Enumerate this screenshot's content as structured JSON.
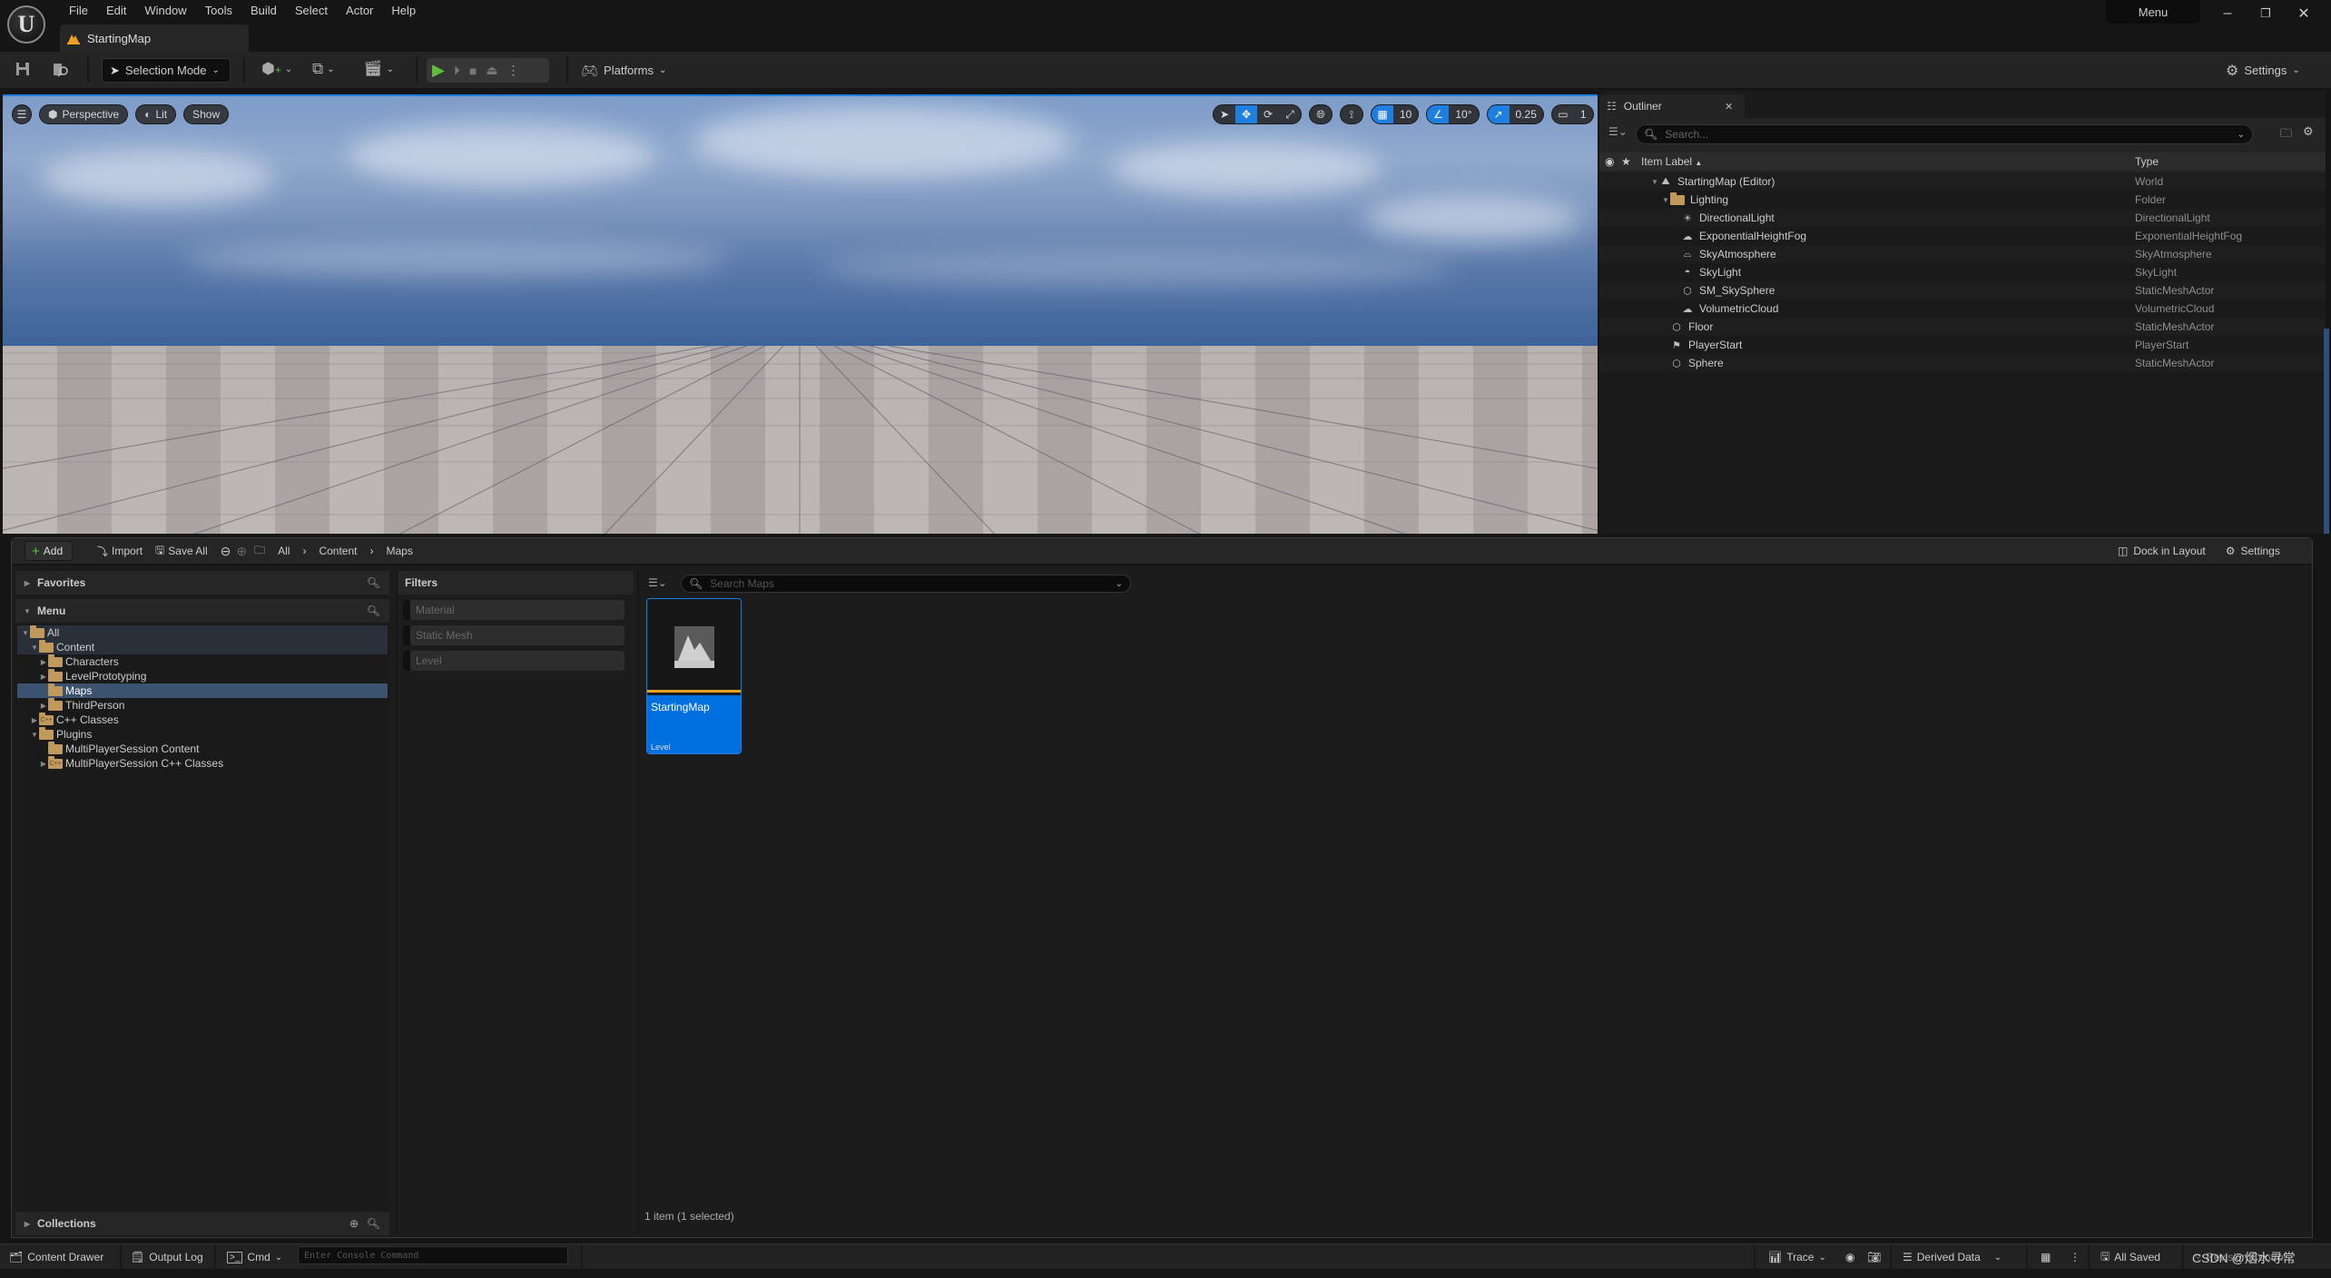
{
  "app": {
    "logo": "U",
    "menu": [
      "File",
      "Edit",
      "Window",
      "Tools",
      "Build",
      "Select",
      "Actor",
      "Help"
    ],
    "document_tab": "StartingMap",
    "menu_button": "Menu",
    "window_controls": {
      "minimize": "–",
      "restore": "❐",
      "close": "✕"
    }
  },
  "toolbar": {
    "selection_mode": "Selection Mode",
    "platforms": "Platforms",
    "settings": "Settings"
  },
  "viewport": {
    "view_mode": "Perspective",
    "lighting": "Lit",
    "show": "Show",
    "grid_snap": "10",
    "rotation_snap": "10°",
    "scale_snap": "0.25",
    "camera_speed": "1",
    "active_tool": "translate"
  },
  "outliner": {
    "tab_title": "Outliner",
    "search_placeholder": "Search...",
    "columns": {
      "label": "Item Label",
      "type": "Type"
    },
    "rows": [
      {
        "label": "StartingMap (Editor)",
        "type": "World",
        "icon": "world-icon",
        "depth": 0,
        "expanded": true
      },
      {
        "label": "Lighting",
        "type": "Folder",
        "icon": "folder-icon",
        "depth": 1,
        "expanded": true
      },
      {
        "label": "DirectionalLight",
        "type": "DirectionalLight",
        "icon": "directional-light-icon",
        "depth": 2
      },
      {
        "label": "ExponentialHeightFog",
        "type": "ExponentialHeightFog",
        "icon": "fog-icon",
        "depth": 2
      },
      {
        "label": "SkyAtmosphere",
        "type": "SkyAtmosphere",
        "icon": "sky-atmosphere-icon",
        "depth": 2
      },
      {
        "label": "SkyLight",
        "type": "SkyLight",
        "icon": "sky-light-icon",
        "depth": 2
      },
      {
        "label": "SM_SkySphere",
        "type": "StaticMeshActor",
        "icon": "static-mesh-icon",
        "depth": 2
      },
      {
        "label": "VolumetricCloud",
        "type": "VolumetricCloud",
        "icon": "volumetric-cloud-icon",
        "depth": 2
      },
      {
        "label": "Floor",
        "type": "StaticMeshActor",
        "icon": "static-mesh-icon",
        "depth": 1
      },
      {
        "label": "PlayerStart",
        "type": "PlayerStart",
        "icon": "player-start-icon",
        "depth": 1
      },
      {
        "label": "Sphere",
        "type": "StaticMeshActor",
        "icon": "static-mesh-icon",
        "depth": 1
      }
    ]
  },
  "content_browser": {
    "add": "Add",
    "import": "Import",
    "save_all": "Save All",
    "breadcrumb": [
      "All",
      "Content",
      "Maps"
    ],
    "dock_in_layout": "Dock in Layout",
    "settings": "Settings",
    "favorites": "Favorites",
    "menu": "Menu",
    "tree": [
      {
        "label": "All",
        "depth": 0,
        "arrow": "down",
        "state": "highlight"
      },
      {
        "label": "Content",
        "depth": 1,
        "arrow": "down",
        "state": "highlight"
      },
      {
        "label": "Characters",
        "depth": 2,
        "arrow": "right",
        "state": ""
      },
      {
        "label": "LevelPrototyping",
        "depth": 2,
        "arrow": "right",
        "state": ""
      },
      {
        "label": "Maps",
        "depth": 2,
        "arrow": "",
        "state": "selected"
      },
      {
        "label": "ThirdPerson",
        "depth": 2,
        "arrow": "right",
        "state": ""
      },
      {
        "label": "C++ Classes",
        "depth": 1,
        "arrow": "right",
        "state": "",
        "cpp": true
      },
      {
        "label": "Plugins",
        "depth": 1,
        "arrow": "down",
        "state": ""
      },
      {
        "label": "MultiPlayerSession Content",
        "depth": 2,
        "arrow": "",
        "state": ""
      },
      {
        "label": "MultiPlayerSession C++ Classes",
        "depth": 2,
        "arrow": "right",
        "state": "",
        "cpp": true
      }
    ],
    "collections": "Collections",
    "filters_title": "Filters",
    "filters": [
      "Material",
      "Static Mesh",
      "Level"
    ],
    "search_placeholder": "Search Maps",
    "assets": [
      {
        "name": "StartingMap",
        "type": "Level",
        "selected": true
      }
    ],
    "item_count": "1 item (1 selected)"
  },
  "statusbar": {
    "content_drawer": "Content Drawer",
    "output_log": "Output Log",
    "cmd": "Cmd",
    "console_placeholder": "Enter Console Command",
    "trace": "Trace",
    "derived_data": "Derived Data",
    "all_saved": "All Saved",
    "revision_control": "Revision Control",
    "watermark": "CSDN @烟水寻常"
  },
  "colors": {
    "accent": "#1f7fe0",
    "selection": "#0070e0",
    "folder": "#c19a5b",
    "play": "#5fbf3a",
    "level_tile_stripe": "#f0a020"
  }
}
